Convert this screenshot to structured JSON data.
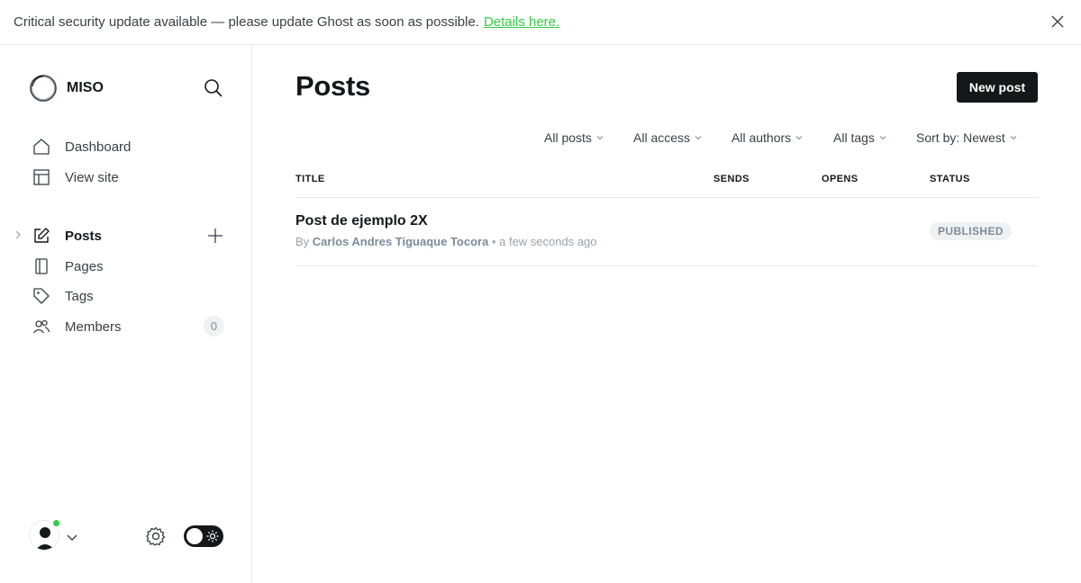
{
  "banner": {
    "message": "Critical security update available — please update Ghost as soon as possible.",
    "link_text": "Details here."
  },
  "sidebar": {
    "site_name": "MISO",
    "nav_top": [
      {
        "label": "Dashboard",
        "icon": "home-icon"
      },
      {
        "label": "View site",
        "icon": "layout-icon"
      }
    ],
    "nav_main": [
      {
        "label": "Posts",
        "icon": "edit-icon",
        "active": true
      },
      {
        "label": "Pages",
        "icon": "pages-icon"
      },
      {
        "label": "Tags",
        "icon": "tag-icon"
      },
      {
        "label": "Members",
        "icon": "members-icon",
        "count": "0"
      }
    ]
  },
  "main": {
    "title": "Posts",
    "new_post_label": "New post",
    "filters": [
      "All posts",
      "All access",
      "All authors",
      "All tags",
      "Sort by: Newest"
    ],
    "columns": [
      "TITLE",
      "SENDS",
      "OPENS",
      "STATUS"
    ],
    "posts": [
      {
        "title": "Post de ejemplo 2X",
        "by": "By",
        "author": "Carlos Andres Tiguaque Tocora",
        "time": "• a few seconds ago",
        "status": "PUBLISHED"
      }
    ]
  },
  "colors": {
    "accent_green": "#30cf43",
    "primary_dark": "#15171a",
    "muted": "#7c8b9a"
  }
}
